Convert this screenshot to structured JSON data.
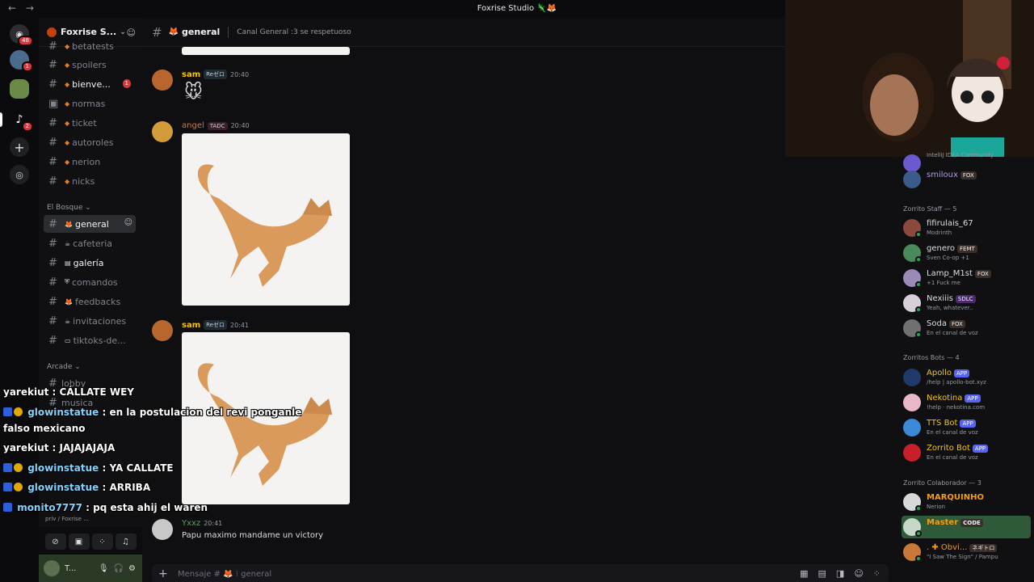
{
  "window": {
    "title": "Foxrise Studio 🦎🦊",
    "nav": "← →"
  },
  "rail": {
    "servers": [
      {
        "name": "discord-home",
        "badge": "48"
      },
      {
        "name": "server-avatar-1",
        "badge": "1"
      },
      {
        "name": "server-avatar-2",
        "badge": ""
      },
      {
        "name": "server-avatar-3",
        "badge": "2"
      }
    ]
  },
  "server": {
    "name": "Foxrise S...",
    "chevron": "⌄"
  },
  "channels": [
    {
      "label": "betatests"
    },
    {
      "label": "spoilers"
    },
    {
      "label": "bienve...",
      "unread": "1"
    },
    {
      "label": "normas"
    },
    {
      "label": "ticket"
    },
    {
      "label": "autoroles"
    },
    {
      "label": "nerion"
    },
    {
      "label": "nicks"
    }
  ],
  "category_bosque": "El Bosque",
  "bosque_channels": [
    {
      "label": "general"
    },
    {
      "label": "cafeteria"
    },
    {
      "label": "galería"
    },
    {
      "label": "comandos"
    },
    {
      "label": "feedbacks"
    },
    {
      "label": "invitaciones"
    },
    {
      "label": "tiktoks-de..."
    }
  ],
  "category_arcade": "Arcade",
  "arcade_channels": [
    {
      "label": "lobby"
    },
    {
      "label": "musica"
    }
  ],
  "userpanel": {
    "status_line": "priv / Foxrise ...",
    "username": "T..."
  },
  "chat": {
    "channel": "general",
    "topic": "Canal General :3 se respetuoso",
    "messages": [
      {
        "author": "sam",
        "tag": "Reゼロ",
        "time": "20:40"
      },
      {
        "author": "angel",
        "tag": "TADC",
        "time": "20:40"
      },
      {
        "author": "sam",
        "tag": "Reゼロ",
        "time": "20:41"
      },
      {
        "author": "Yxxz",
        "time": "20:41",
        "text": "Papu maximo mandame un victory"
      }
    ],
    "composer_placeholder": "Mensaje # 🦊 ⁝ general"
  },
  "members": {
    "top": [
      {
        "name": "",
        "sub": "IntelliJ IDEA Community"
      },
      {
        "name": "smiloux",
        "tag": "FOX"
      }
    ],
    "staff_header": "Zorrito Staff — 5",
    "staff": [
      {
        "name": "fifirulais_67",
        "sub": "Modrinth"
      },
      {
        "name": "genero",
        "tag": "FEMT",
        "sub": "Sven Co-op +1"
      },
      {
        "name": "Lamp_M1st",
        "tag": "FOX",
        "sub": "+1 Fuck me"
      },
      {
        "name": "Nexiiis",
        "tag": "SDLC",
        "sub": "Yeah, whatever.."
      },
      {
        "name": "Soda",
        "tag": "FOX",
        "sub": "En el canal de voz"
      }
    ],
    "bots_header": "Zorritos Bots — 4",
    "bots": [
      {
        "name": "Apollo",
        "tag": "APP",
        "sub": "/help | apollo-bot.xyz"
      },
      {
        "name": "Nekotina",
        "tag": "APP",
        "sub": "!help · nekotina.com"
      },
      {
        "name": "TTS Bot",
        "tag": "APP",
        "sub": "En el canal de voz"
      },
      {
        "name": "Zorrito Bot",
        "tag": "APP",
        "sub": "En el canal de voz"
      }
    ],
    "colab_header": "Zorrito Colaborador — 3",
    "colab": [
      {
        "name": "MARQUINHO",
        "sub": "Nerion"
      },
      {
        "name": "Master",
        "tag": "CODE",
        "sub": ""
      },
      {
        "name": ". ✚ Obvi...",
        "tag": "ネギトロ",
        "sub": "\"I Saw The Sign\" / Pampu"
      }
    ]
  },
  "twitch_chat": [
    {
      "user": "yarekiut",
      "text": ": CÁLLATE WEY"
    },
    {
      "user": "glowinstatue",
      "text": ": en la postulacion del revi ponganle"
    },
    {
      "user": "",
      "text": "falso mexicano"
    },
    {
      "user": "yarekiut",
      "text": ": JAJAJAJAJA"
    },
    {
      "user": "glowinstatue",
      "text": ": YA CALLATE"
    },
    {
      "user": "glowinstatue",
      "text": ": ARRIBA"
    },
    {
      "user": "monito7777",
      "text": ": pq esta ahij el waren"
    }
  ],
  "colors": {
    "accent": "#5865f2",
    "danger": "#da373c",
    "online": "#23a55a",
    "fox": "#e67e22"
  }
}
